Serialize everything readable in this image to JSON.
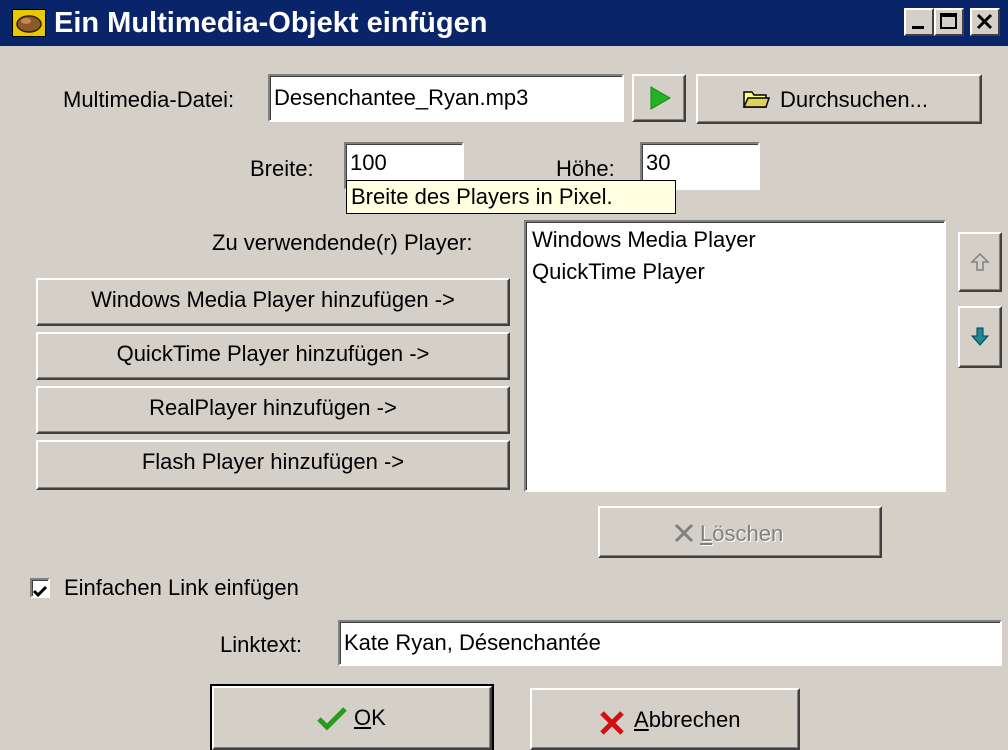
{
  "window": {
    "title": "Ein Multimedia-Objekt einfügen"
  },
  "file": {
    "label": "Multimedia-Datei:",
    "value": "Desenchantee_Ryan.mp3"
  },
  "browse_label": "Durchsuchen...",
  "width": {
    "label": "Breite:",
    "value": "100"
  },
  "height": {
    "label": "Höhe:",
    "value": "30"
  },
  "tooltip": "Breite des Players in Pixel.",
  "players": {
    "label": "Zu verwendende(r) Player:",
    "items": [
      "Windows Media Player",
      "QuickTime Player"
    ]
  },
  "add_buttons": [
    "Windows Media Player hinzufügen ->",
    "QuickTime Player hinzufügen ->",
    "RealPlayer hinzufügen ->",
    "Flash Player hinzufügen ->"
  ],
  "delete": {
    "first": "L",
    "rest": "öschen"
  },
  "link_checkbox": {
    "label": "Einfachen Link einfügen",
    "checked": true
  },
  "linktext": {
    "label": "Linktext:",
    "value": "Kate Ryan, Désenchantée"
  },
  "ok": {
    "first": "O",
    "rest": "K"
  },
  "cancel": {
    "first": "A",
    "rest": "bbrechen"
  },
  "colors": {
    "titlebar": "#0a246a",
    "face": "#d4d0c8",
    "play": "#22b222",
    "ok_check": "#2a9a1a",
    "cancel_x": "#d01010",
    "arrow_down": "#1a8a9a"
  },
  "icons": [
    "app-icon",
    "minimize-icon",
    "maximize-icon",
    "close-icon",
    "play-icon",
    "folder-icon",
    "arrow-up-icon",
    "arrow-down-icon",
    "delete-x-icon",
    "checkmark-icon",
    "cancel-x-icon"
  ]
}
